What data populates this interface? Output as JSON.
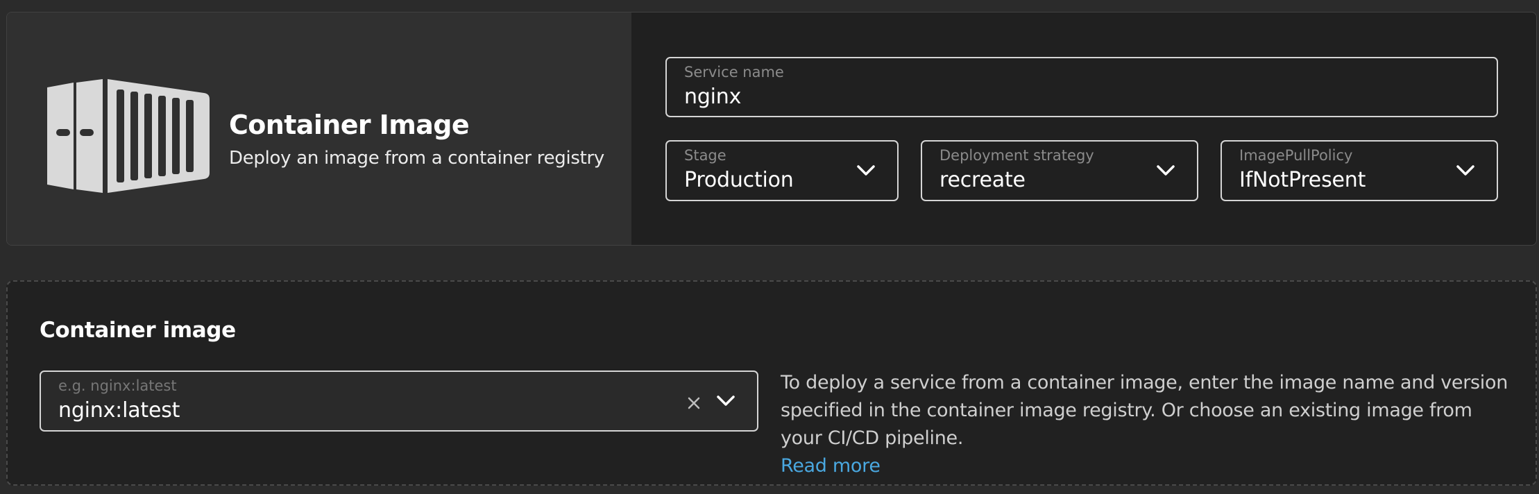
{
  "hero": {
    "icon": "container-icon",
    "title": "Container Image",
    "subtitle": "Deploy an image from a container registry"
  },
  "config": {
    "service_name": {
      "label": "Service name",
      "value": "nginx"
    },
    "stage": {
      "label": "Stage",
      "value": "Production",
      "icon": "chevron-down-icon"
    },
    "deployment_strategy": {
      "label": "Deployment strategy",
      "value": "recreate",
      "icon": "chevron-down-icon"
    },
    "image_pull_policy": {
      "label": "ImagePullPolicy",
      "value": "IfNotPresent",
      "icon": "chevron-down-icon"
    }
  },
  "container_image": {
    "title": "Container image",
    "input": {
      "placeholder": "e.g. nginx:latest",
      "value": "nginx:latest",
      "clear_icon": "close-icon",
      "dropdown_icon": "chevron-down-icon"
    },
    "help_text": "To deploy a service from a container image, enter the image name and version specified in the container image registry. Or choose an existing image from your CI/CD pipeline.",
    "read_more": "Read more"
  },
  "colors": {
    "background": "#2b2b2b",
    "hero_panel": "#303030",
    "config_panel": "#202020",
    "field_border": "#d6d6d6",
    "link": "#4aa8e0"
  }
}
